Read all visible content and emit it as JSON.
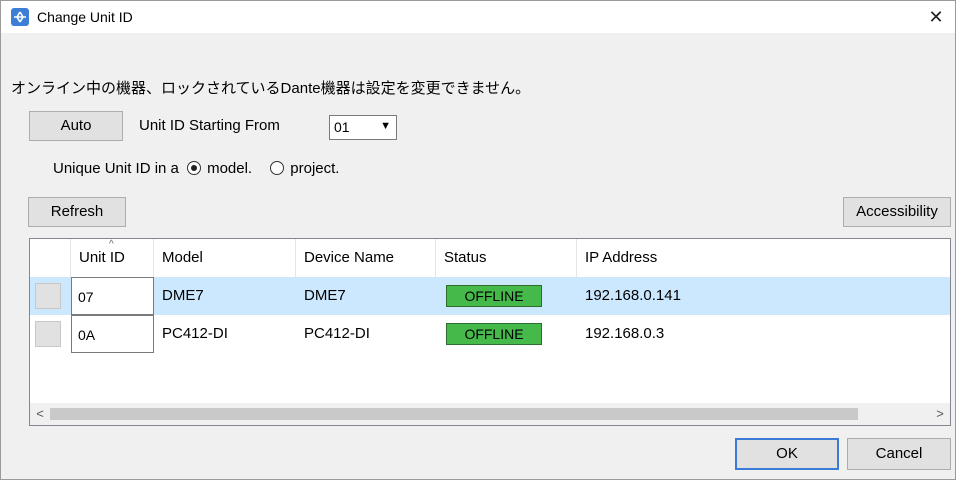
{
  "window": {
    "title": "Change Unit ID",
    "close_glyph": "✕",
    "accent": "#3d7fd6"
  },
  "notice": "オンライン中の機器、ロックされているDante機器は設定を変更できません。",
  "controls": {
    "auto_label": "Auto",
    "start_label": "Unit ID Starting From",
    "start_value": "01",
    "unique_label": "Unique Unit ID in a",
    "radio_model": "model.",
    "radio_project": "project.",
    "selected_scope": "model",
    "refresh_label": "Refresh",
    "accessibility_label": "Accessibility"
  },
  "table": {
    "columns": [
      "Unit ID",
      "Model",
      "Device Name",
      "Status",
      "IP Address"
    ],
    "sort_glyph": "^",
    "rows": [
      {
        "unit_id": "07",
        "model": "DME7",
        "device_name": "DME7",
        "status": "OFFLINE",
        "ip": "192.168.0.141",
        "selected": true
      },
      {
        "unit_id": "0A",
        "model": "PC412-DI",
        "device_name": "PC412-DI",
        "status": "OFFLINE",
        "ip": "192.168.0.3",
        "selected": false
      }
    ],
    "status_color": "#45b94a",
    "scroll_left": "<",
    "scroll_right": ">"
  },
  "footer": {
    "ok_label": "OK",
    "cancel_label": "Cancel"
  }
}
